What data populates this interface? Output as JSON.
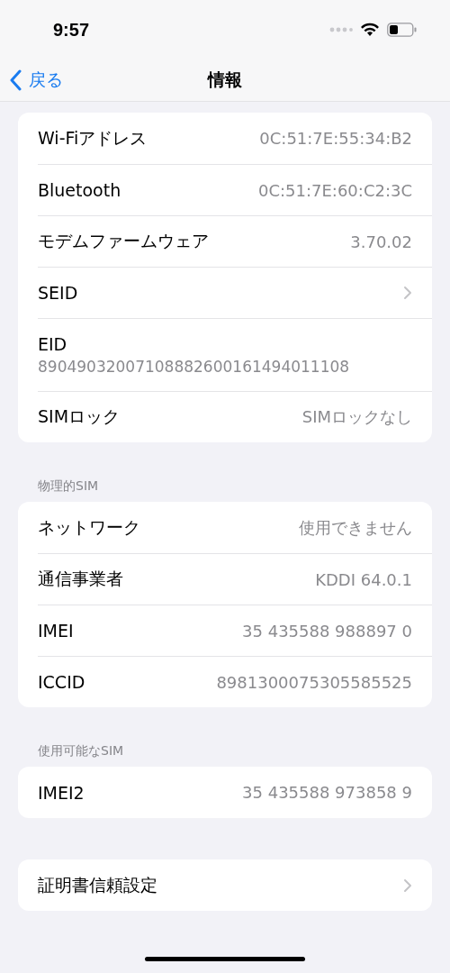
{
  "status_bar": {
    "time": "9:57"
  },
  "nav": {
    "back": "戻る",
    "title": "情報"
  },
  "sections": [
    {
      "rows": [
        {
          "kind": "value",
          "label": "Wi-Fiアドレス",
          "value": "0C:51:7E:55:34:B2"
        },
        {
          "kind": "value",
          "label": "Bluetooth",
          "value": "0C:51:7E:60:C2:3C"
        },
        {
          "kind": "value",
          "label": "モデムファームウェア",
          "value": "3.70.02"
        },
        {
          "kind": "chevron",
          "label": "SEID"
        },
        {
          "kind": "stacked",
          "label": "EID",
          "value": "89049032007108882600161494011108"
        },
        {
          "kind": "value",
          "label": "SIMロック",
          "value": "SIMロックなし"
        }
      ]
    },
    {
      "header": "物理的SIM",
      "rows": [
        {
          "kind": "value",
          "label": "ネットワーク",
          "value": "使用できません"
        },
        {
          "kind": "value",
          "label": "通信事業者",
          "value": "KDDI 64.0.1"
        },
        {
          "kind": "value",
          "label": "IMEI",
          "value": "35 435588 988897 0"
        },
        {
          "kind": "value",
          "label": "ICCID",
          "value": "8981300075305585525"
        }
      ]
    },
    {
      "header": "使用可能なSIM",
      "rows": [
        {
          "kind": "value",
          "label": "IMEI2",
          "value": "35 435588 973858 9"
        }
      ]
    },
    {
      "rows": [
        {
          "kind": "chevron",
          "label": "証明書信頼設定"
        }
      ]
    }
  ]
}
